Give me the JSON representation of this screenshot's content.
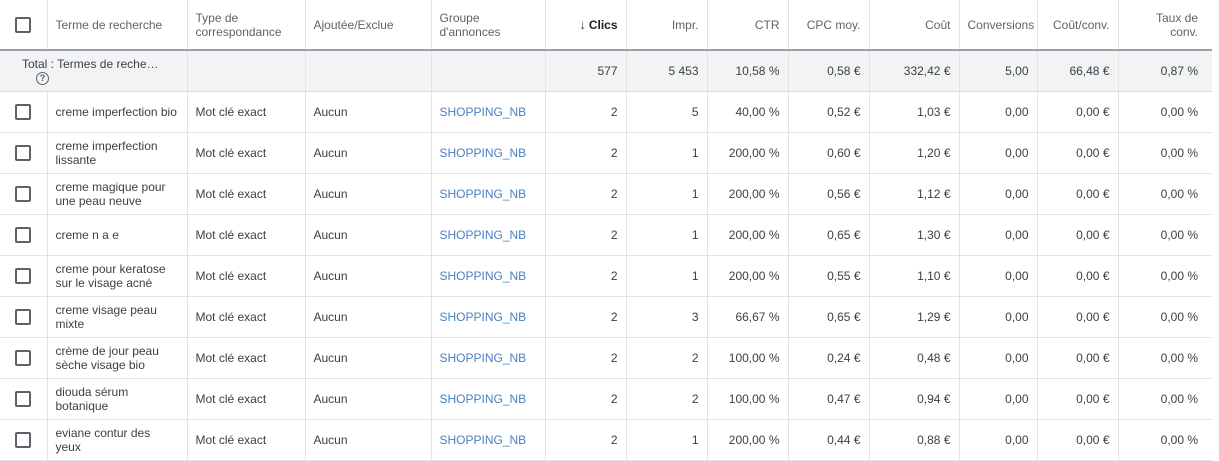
{
  "header": {
    "search_term": "Terme de recherche",
    "match_type": "Type de correspondance",
    "added_excluded": "Ajoutée/Exclue",
    "ad_group": "Groupe d'annonces",
    "clicks": "Clics",
    "impressions": "Impr.",
    "ctr": "CTR",
    "avg_cpc": "CPC moy.",
    "cost": "Coût",
    "conversions": "Conversions",
    "cost_conv": "Coût/conv.",
    "conv_rate": "Taux de conv."
  },
  "total": {
    "label": "Total : Termes de reche…",
    "clicks": "577",
    "impressions": "5 453",
    "ctr": "10,58 %",
    "avg_cpc": "0,58 €",
    "cost": "332,42 €",
    "conversions": "5,00",
    "cost_conv": "66,48 €",
    "conv_rate": "0,87 %"
  },
  "rows": [
    {
      "term": "creme imperfection bio",
      "match": "Mot clé exact",
      "added": "Aucun",
      "group": "SHOPPING_NB",
      "clicks": "2",
      "impr": "5",
      "ctr": "40,00 %",
      "cpc": "0,52 €",
      "cost": "1,03 €",
      "conv": "0,00",
      "cost_conv": "0,00 €",
      "conv_rate": "0,00 %"
    },
    {
      "term": "creme imperfection lissante",
      "match": "Mot clé exact",
      "added": "Aucun",
      "group": "SHOPPING_NB",
      "clicks": "2",
      "impr": "1",
      "ctr": "200,00 %",
      "cpc": "0,60 €",
      "cost": "1,20 €",
      "conv": "0,00",
      "cost_conv": "0,00 €",
      "conv_rate": "0,00 %"
    },
    {
      "term": "creme magique pour une peau neuve",
      "match": "Mot clé exact",
      "added": "Aucun",
      "group": "SHOPPING_NB",
      "clicks": "2",
      "impr": "1",
      "ctr": "200,00 %",
      "cpc": "0,56 €",
      "cost": "1,12 €",
      "conv": "0,00",
      "cost_conv": "0,00 €",
      "conv_rate": "0,00 %"
    },
    {
      "term": "creme n a e",
      "match": "Mot clé exact",
      "added": "Aucun",
      "group": "SHOPPING_NB",
      "clicks": "2",
      "impr": "1",
      "ctr": "200,00 %",
      "cpc": "0,65 €",
      "cost": "1,30 €",
      "conv": "0,00",
      "cost_conv": "0,00 €",
      "conv_rate": "0,00 %"
    },
    {
      "term": "creme pour keratose sur le visage acné",
      "match": "Mot clé exact",
      "added": "Aucun",
      "group": "SHOPPING_NB",
      "clicks": "2",
      "impr": "1",
      "ctr": "200,00 %",
      "cpc": "0,55 €",
      "cost": "1,10 €",
      "conv": "0,00",
      "cost_conv": "0,00 €",
      "conv_rate": "0,00 %"
    },
    {
      "term": "creme visage peau mixte",
      "match": "Mot clé exact",
      "added": "Aucun",
      "group": "SHOPPING_NB",
      "clicks": "2",
      "impr": "3",
      "ctr": "66,67 %",
      "cpc": "0,65 €",
      "cost": "1,29 €",
      "conv": "0,00",
      "cost_conv": "0,00 €",
      "conv_rate": "0,00 %"
    },
    {
      "term": "crème de jour peau sèche visage bio",
      "match": "Mot clé exact",
      "added": "Aucun",
      "group": "SHOPPING_NB",
      "clicks": "2",
      "impr": "2",
      "ctr": "100,00 %",
      "cpc": "0,24 €",
      "cost": "0,48 €",
      "conv": "0,00",
      "cost_conv": "0,00 €",
      "conv_rate": "0,00 %"
    },
    {
      "term": "diouda sérum botanique",
      "match": "Mot clé exact",
      "added": "Aucun",
      "group": "SHOPPING_NB",
      "clicks": "2",
      "impr": "2",
      "ctr": "100,00 %",
      "cpc": "0,47 €",
      "cost": "0,94 €",
      "conv": "0,00",
      "cost_conv": "0,00 €",
      "conv_rate": "0,00 %"
    },
    {
      "term": "eviane contur des yeux",
      "match": "Mot clé exact",
      "added": "Aucun",
      "group": "SHOPPING_NB",
      "clicks": "2",
      "impr": "1",
      "ctr": "200,00 %",
      "cpc": "0,44 €",
      "cost": "0,88 €",
      "conv": "0,00",
      "cost_conv": "0,00 €",
      "conv_rate": "0,00 %"
    }
  ]
}
